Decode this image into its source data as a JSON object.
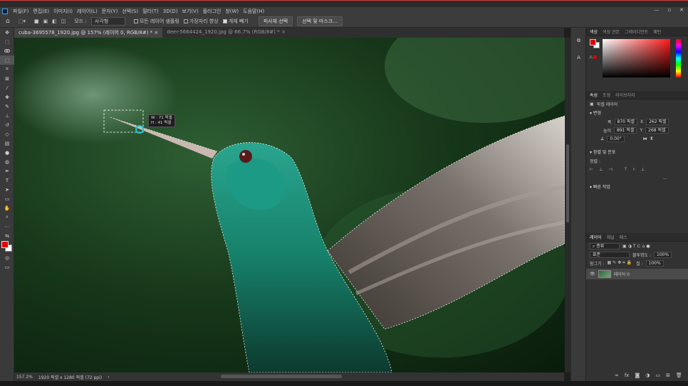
{
  "menu": [
    "파일(F)",
    "편집(E)",
    "이미지(I)",
    "레이어(L)",
    "문자(Y)",
    "선택(S)",
    "필터(T)",
    "3D(D)",
    "보기(V)",
    "플러그인",
    "창(W)",
    "도움말(H)"
  ],
  "window_controls": {
    "min": "—",
    "max": "▫",
    "close": "✕"
  },
  "options": {
    "mode_label": "모드 :",
    "mode_value": "사각형",
    "sample_all": "모든 레이어 샘플링",
    "hard_edge": "가장자리 향상",
    "subtract": "개체 빼기",
    "select_subject": "피사체 선택",
    "select_mask": "선택 및 마스크..."
  },
  "tabs": [
    {
      "label": "cuba-3695578_1920.jpg @ 157% (레이어 0, RGB/8#) *",
      "close": "×"
    },
    {
      "label": "deer-5664424_1920.jpg @ 66.7% (RGB/8#) *",
      "close": "×"
    }
  ],
  "tooltip": {
    "w": "W : 71 픽셀",
    "h": "H : 41 픽셀"
  },
  "status": {
    "zoom": "157.2%",
    "doc": "1920 픽셀 x 1280 픽셀 (72 ppi)"
  },
  "colors": {
    "fg": "#e50000",
    "bg": "#ffffff"
  },
  "color_panel": {
    "tabs": [
      "색상",
      "색상 견본",
      "그레이디언트",
      "패턴"
    ]
  },
  "properties_panel": {
    "tabs": [
      "속성",
      "조정",
      "라이브러리"
    ],
    "layer_type": "픽셀 레이어",
    "transform": "변형",
    "w_label": "폭",
    "w": "870 픽셀",
    "x_label": "X",
    "x": "262 픽셀",
    "h_label": "높이",
    "h": "891 픽셀",
    "y_label": "Y",
    "y": "268 픽셀",
    "angle": "0.00°",
    "align": "정렬 및 분포",
    "align_label": "정렬 :",
    "quick": "빠른 작업",
    "more": "..."
  },
  "layers_panel": {
    "tabs": [
      "레이어",
      "채널",
      "패스"
    ],
    "kind": "종류",
    "blend": "표준",
    "opacity_label": "불투명도 :",
    "opacity": "100%",
    "lock_label": "잠그기 :",
    "fill_label": "칠 :",
    "fill": "100%",
    "layer_name": "레이어 0"
  }
}
